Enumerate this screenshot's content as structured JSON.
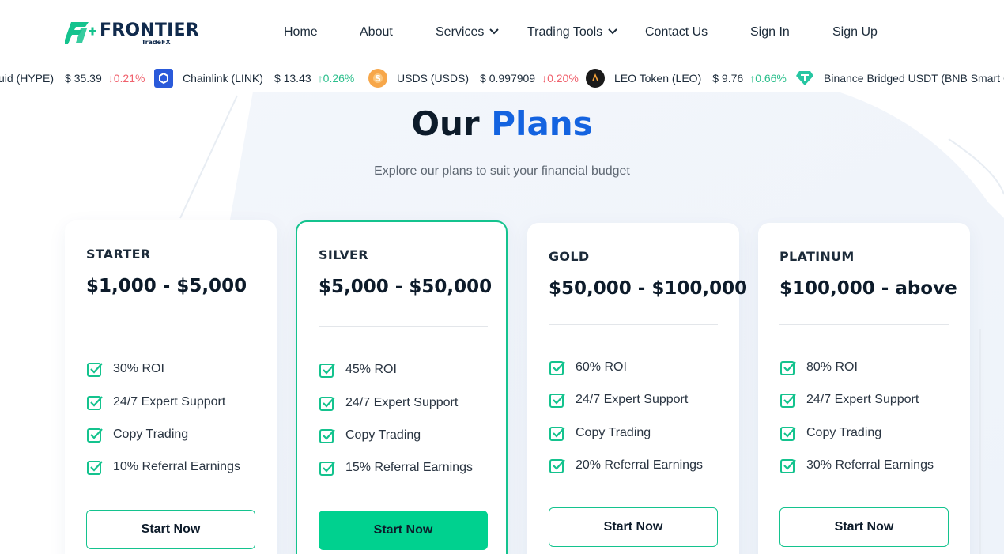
{
  "brand": {
    "name": "FRONTIER",
    "sub": "TradeFX",
    "accent_color": "#14c38e",
    "navy": "#102a4c"
  },
  "nav": {
    "home": "Home",
    "about": "About",
    "services": "Services",
    "trading_tools": "Trading Tools",
    "contact": "Contact Us",
    "sign_in": "Sign In",
    "sign_up": "Sign Up"
  },
  "ticker": [
    {
      "name": "uid (HYPE)",
      "price": "$ 35.39",
      "change": "0.21%",
      "direction": "down",
      "icon": "hyperliquid-coin-icon"
    },
    {
      "name": "Chainlink (LINK)",
      "price": "$ 13.43",
      "change": "0.26%",
      "direction": "up",
      "icon": "chainlink-coin-icon"
    },
    {
      "name": "USDS (USDS)",
      "price": "$ 0.997909",
      "change": "0.20%",
      "direction": "down",
      "icon": "usds-coin-icon"
    },
    {
      "name": "LEO Token (LEO)",
      "price": "$ 9.76",
      "change": "0.66%",
      "direction": "up",
      "icon": "leo-coin-icon"
    },
    {
      "name": "Binance Bridged USDT (BNB Smart C",
      "price": "",
      "change": "",
      "direction": "",
      "icon": "tether-coin-icon"
    }
  ],
  "section": {
    "title_part1": "Our",
    "title_part2": "Plans",
    "subtitle": "Explore our plans to suit your financial budget"
  },
  "plans": [
    {
      "name": "STARTER",
      "range": "$1,000 - $5,000",
      "features": [
        "30% ROI",
        "24/7 Expert Support",
        "Copy Trading",
        "10% Referral Earnings"
      ],
      "button": "Start Now"
    },
    {
      "name": "SILVER",
      "range": "$5,000 - $50,000",
      "features": [
        "45% ROI",
        "24/7 Expert Support",
        "Copy Trading",
        "15% Referral Earnings"
      ],
      "button": "Start Now"
    },
    {
      "name": "GOLD",
      "range": "$50,000 - $100,000",
      "features": [
        "60% ROI",
        "24/7 Expert Support",
        "Copy Trading",
        "20% Referral Earnings"
      ],
      "button": "Start Now"
    },
    {
      "name": "PLATINUM",
      "range": "$100,000 - above",
      "features": [
        "80% ROI",
        "24/7 Expert Support",
        "Copy Trading",
        "30% Referral Earnings"
      ],
      "button": "Start Now"
    }
  ]
}
